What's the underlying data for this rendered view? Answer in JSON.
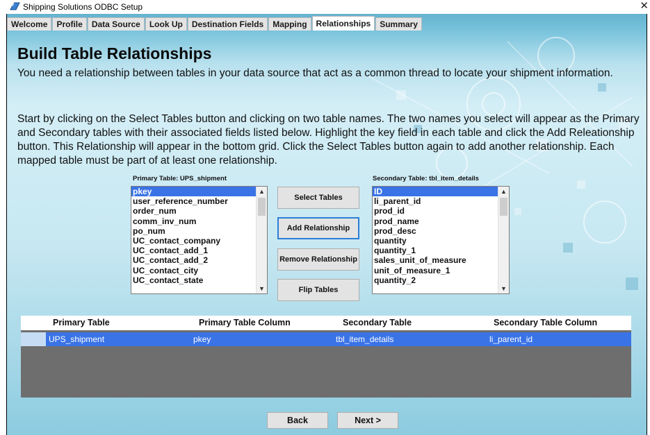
{
  "window": {
    "title": "Shipping Solutions ODBC Setup",
    "close_glyph": "✕"
  },
  "tabs": [
    "Welcome",
    "Profile",
    "Data Source",
    "Look Up",
    "Destination Fields",
    "Mapping",
    "Relationships",
    "Summary"
  ],
  "active_tab": "Relationships",
  "page": {
    "heading": "Build Table Relationships",
    "intro": "You need a relationship between tables in your data source that act as a common thread to locate your shipment information.",
    "instructions": "Start by clicking on the Select Tables button and clicking on two table names. The two names you select will appear as the Primary and Secondary tables with their associated fields listed below. Highlight the key field in each table and click the Add Releationship button. This Relationship will appear in the bottom grid. Click the Select Tables button again to add another relationship. Each mapped table must be part of at least one relationship."
  },
  "primary": {
    "label": "Primary Table:  UPS_shipment",
    "fields": [
      "pkey",
      "user_reference_number",
      "order_num",
      "comm_inv_num",
      "po_num",
      "UC_contact_company",
      "UC_contact_add_1",
      "UC_contact_add_2",
      "UC_contact_city",
      "UC_contact_state"
    ],
    "selected_index": 0
  },
  "secondary": {
    "label": "Secondary Table:  tbl_item_details",
    "fields": [
      "ID",
      "li_parent_id",
      "prod_id",
      "prod_name",
      "prod_desc",
      "quantity",
      "quantity_1",
      "sales_unit_of_measure",
      "unit_of_measure_1",
      "quantity_2"
    ],
    "selected_index": 0
  },
  "buttons": {
    "select_tables": "Select Tables",
    "add_relationship": "Add Relationship",
    "remove_relationship": "Remove Relationship",
    "flip_tables": "Flip Tables",
    "back": "Back",
    "next": "Next >"
  },
  "grid": {
    "columns": [
      "Primary Table",
      "Primary Table Column",
      "Secondary Table",
      "Secondary Table Column"
    ],
    "rows": [
      [
        "UPS_shipment",
        "pkey",
        "tbl_item_details",
        "li_parent_id"
      ]
    ]
  },
  "colors": {
    "selection": "#3a73e6",
    "accent_focus": "#2a7ed6",
    "grid_empty": "#6e6e6e"
  },
  "icons": {
    "app": "shipping-app-icon",
    "scroll_up": "▲",
    "scroll_down": "▼"
  }
}
